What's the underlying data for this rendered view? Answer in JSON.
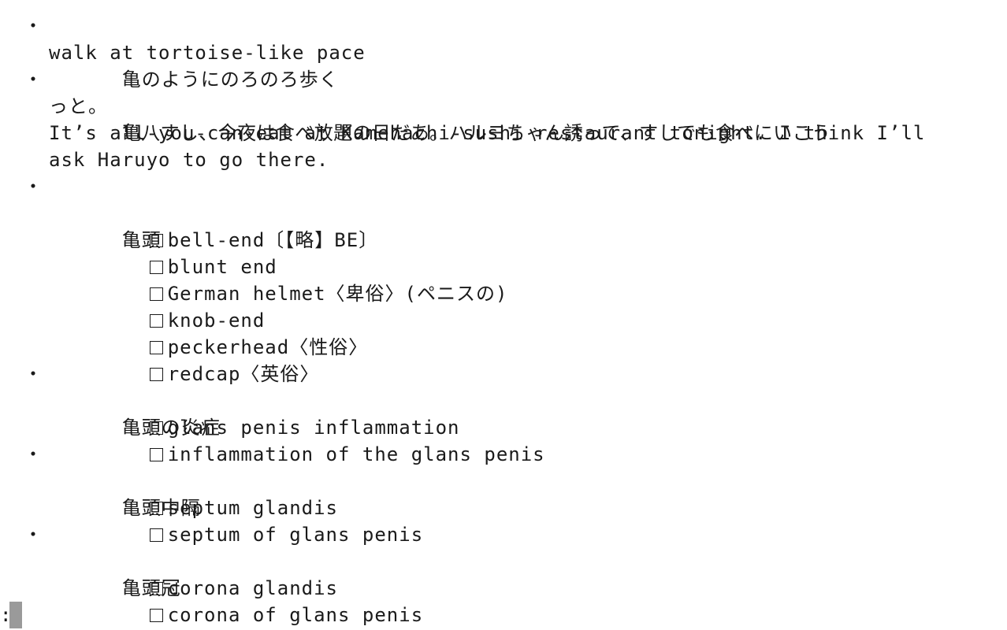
{
  "entries": [
    {
      "headword": "亀のようにのろのろ歩く",
      "gloss": [
        "walk at tortoise-like pace"
      ],
      "items": []
    },
    {
      "headword": "亀八すし、今夜は食べ放題の日だあ。ハルヨちゃん誘って、すしでも食べにいこう",
      "headword_cont": "っと。",
      "gloss": [
        "It’s all-you-can-eat at Kamehachi-sushi restaurant tonight. I think I’ll",
        "ask Haruyo to go there."
      ],
      "items": []
    },
    {
      "headword": "亀頭",
      "gloss": [],
      "items": [
        "bell-end〔【略】BE〕",
        "blunt end",
        "German helmet〈卑俗〉(ペニスの)",
        "knob-end",
        "peckerhead〈性俗〉",
        "redcap〈英俗〉"
      ]
    },
    {
      "headword": "亀頭の炎症",
      "gloss": [],
      "items": [
        "glans penis inflammation",
        "inflammation of the glans penis"
      ]
    },
    {
      "headword": "亀頭中隔",
      "gloss": [],
      "items": [
        "septum glandis",
        "septum of glans penis"
      ]
    },
    {
      "headword": "亀頭冠",
      "gloss": [],
      "items": [
        "corona glandis",
        "corona of glans penis"
      ]
    }
  ],
  "prompt": {
    "symbol": ":"
  },
  "bullet_glyph": "・"
}
